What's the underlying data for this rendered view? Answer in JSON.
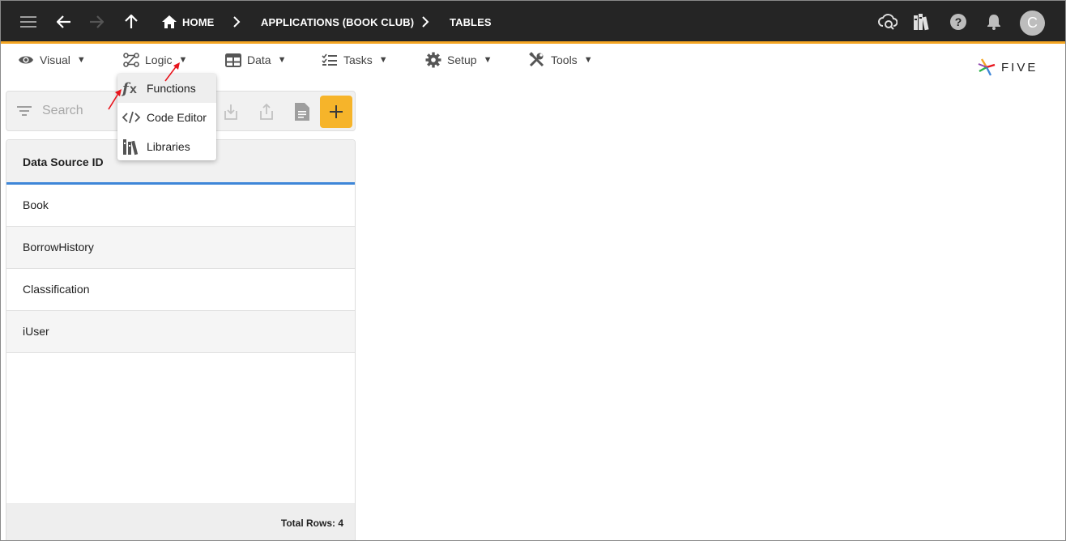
{
  "topbar": {
    "breadcrumbs": {
      "home": "HOME",
      "applications": "APPLICATIONS (BOOK CLUB)",
      "tables": "TABLES"
    },
    "avatar_initial": "C"
  },
  "menubar": {
    "items": [
      {
        "label": "Visual",
        "icon": "eye-icon"
      },
      {
        "label": "Logic",
        "icon": "logic-flow-icon"
      },
      {
        "label": "Data",
        "icon": "table-grid-icon"
      },
      {
        "label": "Tasks",
        "icon": "checklist-icon"
      },
      {
        "label": "Setup",
        "icon": "gear-icon"
      },
      {
        "label": "Tools",
        "icon": "wrench-screwdriver-icon"
      }
    ],
    "caret": "▼"
  },
  "logo": {
    "text": "FIVE"
  },
  "dropdown": {
    "items": [
      {
        "label": "Functions",
        "icon": "function-fx-icon"
      },
      {
        "label": "Code Editor",
        "icon": "code-icon"
      },
      {
        "label": "Libraries",
        "icon": "library-books-icon"
      }
    ]
  },
  "list_panel": {
    "search": {
      "placeholder": "Search"
    },
    "column_header": "Data Source ID",
    "rows": [
      "Book",
      "BorrowHistory",
      "Classification",
      "iUser"
    ],
    "footer": "Total Rows: 4"
  },
  "colors": {
    "topbar_bg": "#252525",
    "accent_orange": "#f5a623",
    "add_button": "#f6b42a",
    "header_underline": "#3e86d8",
    "annotation_arrow": "#e8141c"
  }
}
